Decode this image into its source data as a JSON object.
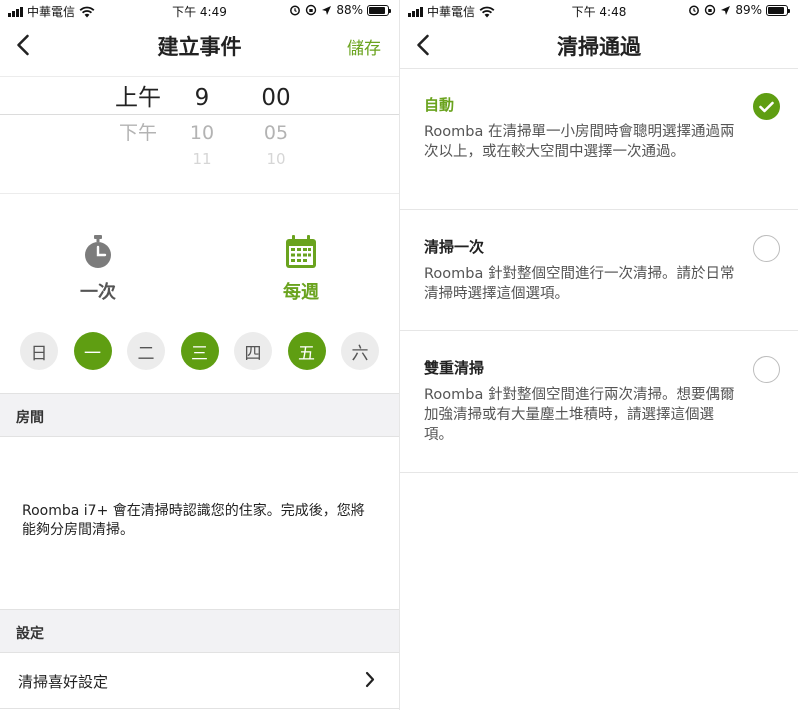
{
  "left": {
    "status": {
      "carrier": "中華電信",
      "time": "下午 4:49",
      "battery": "88%",
      "battery_level": 0.88
    },
    "nav": {
      "title": "建立事件",
      "save_label": "儲存"
    },
    "picker": {
      "period": [
        "上午",
        "下午"
      ],
      "hour": [
        "9",
        "10",
        "11"
      ],
      "minute": [
        "00",
        "05",
        "10"
      ]
    },
    "frequency": {
      "once_label": "一次",
      "weekly_label": "每週",
      "selected": "weekly",
      "accent": "#6aa31e"
    },
    "days": [
      {
        "label": "日",
        "on": false
      },
      {
        "label": "一",
        "on": true
      },
      {
        "label": "二",
        "on": false
      },
      {
        "label": "三",
        "on": true
      },
      {
        "label": "四",
        "on": false
      },
      {
        "label": "五",
        "on": true
      },
      {
        "label": "六",
        "on": false
      }
    ],
    "rooms": {
      "header": "房間",
      "text": "Roomba i7+ 會在清掃時認識您的住家。完成後，您將能夠分房間清掃。"
    },
    "settings": {
      "header": "設定",
      "pref_label": "清掃喜好設定"
    }
  },
  "right": {
    "status": {
      "carrier": "中華電信",
      "time": "下午 4:48",
      "battery": "89%",
      "battery_level": 0.89
    },
    "nav": {
      "title": "清掃通過"
    },
    "options": [
      {
        "title": "自動",
        "desc": "Roomba 在清掃單一小房間時會聰明選擇通過兩次以上，或在較大空間中選擇一次通過。",
        "selected": true
      },
      {
        "title": "清掃一次",
        "desc": "Roomba 針對整個空間進行一次清掃。請於日常清掃時選擇這個選項。",
        "selected": false
      },
      {
        "title": "雙重清掃",
        "desc": "Roomba 針對整個空間進行兩次清掃。想要偶爾加強清掃或有大量塵土堆積時，請選擇這個選項。",
        "selected": false
      }
    ]
  }
}
